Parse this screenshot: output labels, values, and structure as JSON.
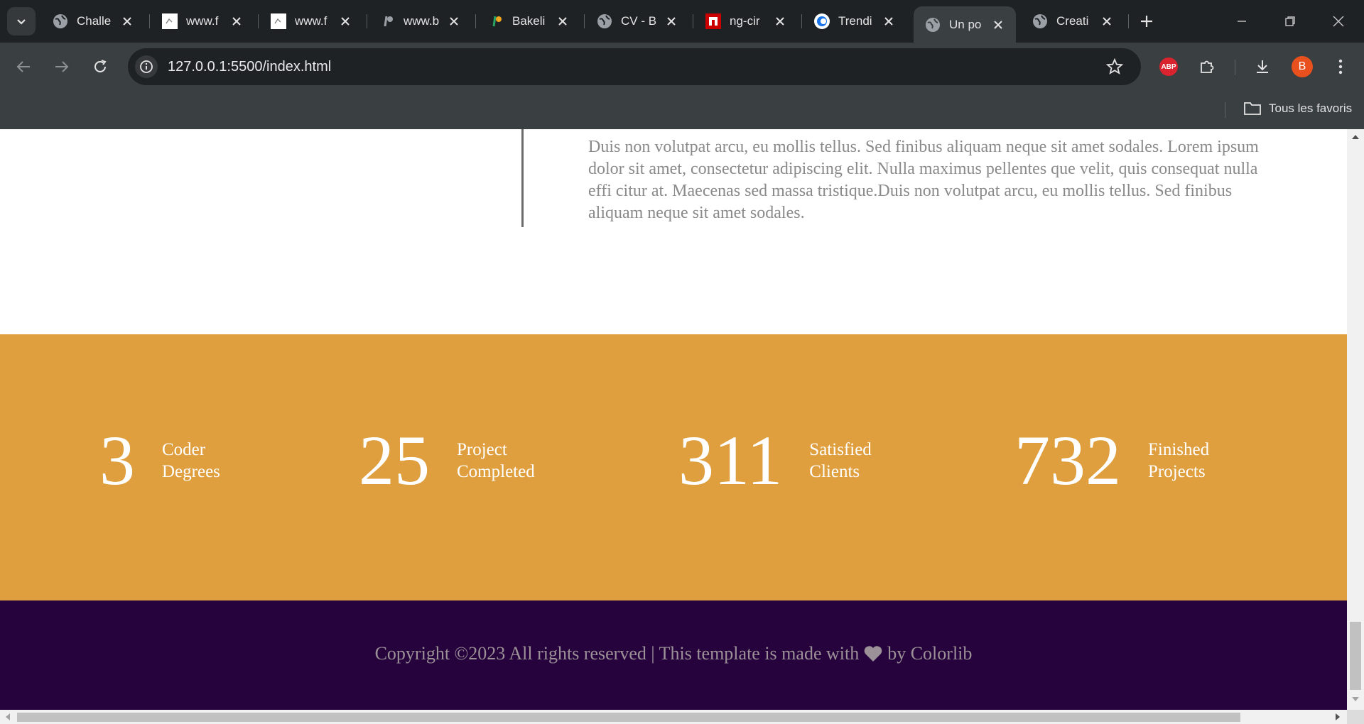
{
  "browser": {
    "tabs": [
      {
        "title": "Challe",
        "icon": "globe-icon"
      },
      {
        "title": "www.f",
        "icon": "site-icon"
      },
      {
        "title": "www.f",
        "icon": "site-icon"
      },
      {
        "title": "www.b",
        "icon": "bakeli-icon"
      },
      {
        "title": "Bakeli",
        "icon": "bakeli-icon"
      },
      {
        "title": "CV - B",
        "icon": "globe-icon"
      },
      {
        "title": "ng-cir",
        "icon": "npm-icon"
      },
      {
        "title": "Trendi",
        "icon": "trending-icon"
      },
      {
        "title": "Un po",
        "icon": "globe-icon",
        "active": true
      },
      {
        "title": "Creati",
        "icon": "globe-icon"
      }
    ],
    "url": "127.0.0.1:5500/index.html",
    "profile_initial": "B",
    "abp_label": "ABP",
    "bookmarks_folder": "Tous les favoris"
  },
  "page": {
    "about_text": "Duis non volutpat arcu, eu mollis tellus. Sed finibus aliquam neque sit amet sodales. Lorem ipsum dolor sit amet, consectetur adipiscing elit. Nulla maximus pellentes que velit, quis consequat nulla effi citur at. Maecenas sed massa tristique.Duis non volutpat arcu, eu mollis tellus. Sed finibus aliquam neque sit amet sodales.",
    "stats": [
      {
        "number": "3",
        "label_line1": "Coder",
        "label_line2": "Degrees"
      },
      {
        "number": "25",
        "label_line1": "Project",
        "label_line2": "Completed"
      },
      {
        "number": "311",
        "label_line1": "Satisfied",
        "label_line2": "Clients"
      },
      {
        "number": "732",
        "label_line1": "Finished",
        "label_line2": "Projects"
      }
    ],
    "footer": {
      "copy_before": "Copyright ©2023 All rights reserved | This template is made with",
      "copy_after": "by Colorlib"
    }
  },
  "colors": {
    "stats_bg": "#df9f3e",
    "footer_bg": "#27033d",
    "tabstrip_bg": "#1f2224",
    "toolbar_bg": "#3a3f42"
  }
}
